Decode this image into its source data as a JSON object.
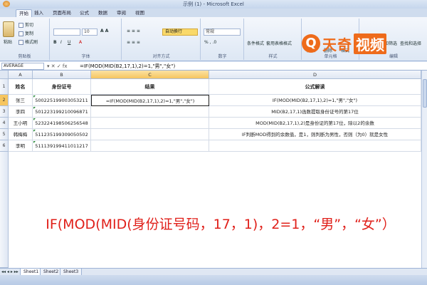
{
  "window": {
    "title": "示例 (1) - Microsoft Excel"
  },
  "tabs": [
    "开始",
    "插入",
    "页面布局",
    "公式",
    "数据",
    "审阅",
    "视图"
  ],
  "ribbon": {
    "paste": "粘贴",
    "cut": "剪切",
    "copy": "复制",
    "format_painter": "格式刷",
    "font_size": "10",
    "wrap": "自动换行",
    "number_format": "常规",
    "cond_format": "条件格式",
    "table_format": "套用表格格式",
    "cell_style": "单元格样式",
    "insert": "插入",
    "delete": "删除",
    "format": "格式",
    "sort_filter": "排序和筛选",
    "find_select": "查找和选择",
    "groups": {
      "clipboard": "剪贴板",
      "font": "字体",
      "alignment": "对齐方式",
      "number": "数字",
      "styles": "样式",
      "cells": "单元格",
      "editing": "编辑"
    }
  },
  "watermark": {
    "name": "天奇",
    "box": "视频"
  },
  "formula_bar": {
    "name_box": "AVERAGE",
    "buttons": "▾ ✕ ✓ fx",
    "formula": "=IF(MOD(MID(B2,17,1),2)=1,\"男\",\"女\")"
  },
  "sheet": {
    "columns": [
      "A",
      "B",
      "C",
      "D"
    ],
    "rows": [
      "1",
      "2",
      "3",
      "4",
      "5",
      "6"
    ],
    "headers": [
      "姓名",
      "身份证号",
      "结果",
      "公式解读"
    ],
    "data": [
      [
        "张三",
        "500225199003053211",
        "=IF(MOD(MID(B2,17,1),2)=1,\"男\",\"女\")",
        "IF(MOD(MID(B2,17,1),2)=1,\"男\",\"女\")"
      ],
      [
        "李四",
        "501223199210096871",
        "",
        "MID(B2,17,1)函数提取身份证号的第17位"
      ],
      [
        "王小明",
        "523224198506256548",
        "",
        "MOD(MID(B2,17,1),2)是身份证的第17位，除以2的余数"
      ],
      [
        "韩梅梅",
        "511235199309050502",
        "",
        "IF判断MOD得到的余数值，是1，则判断为男性，否则（为0）就是女性"
      ],
      [
        "李明",
        "511139199411011217",
        "",
        ""
      ]
    ]
  },
  "overlay": {
    "big_formula": "IF(MOD(MID(身份证号码，17，1)，2=1，“男”，“女”）"
  },
  "sheets": [
    "Sheet1",
    "Sheet2",
    "Sheet3"
  ]
}
